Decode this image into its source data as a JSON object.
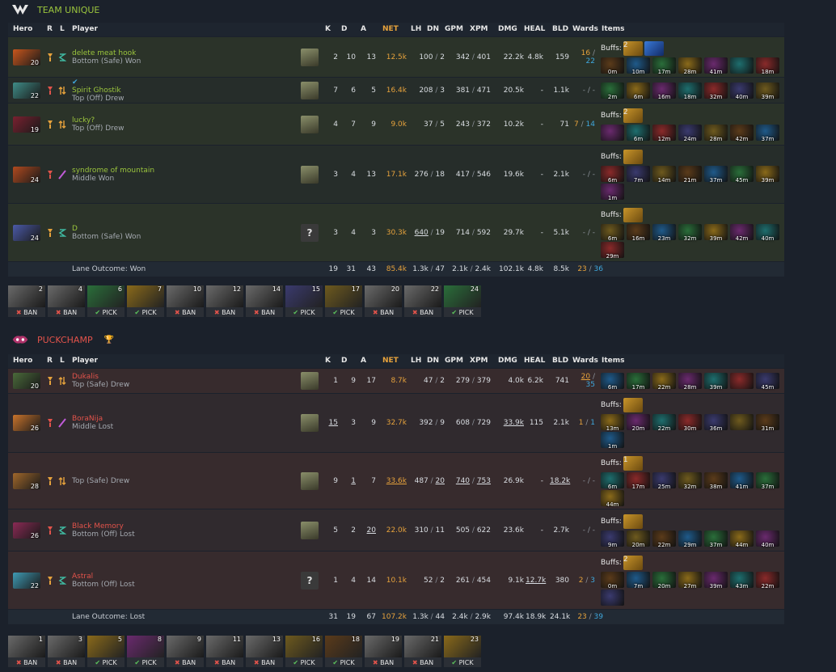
{
  "headers": {
    "hero": "Hero",
    "r": "R",
    "l": "L",
    "player": "Player",
    "k": "K",
    "d": "D",
    "a": "A",
    "net": "NET",
    "lh": "LH",
    "dn": "DN",
    "gpm": "GPM",
    "xpm": "XPM",
    "dmg": "DMG",
    "heal": "HEAL",
    "bld": "BLD",
    "wards": "Wards",
    "items": "Items"
  },
  "buffs_label": "Buffs:",
  "teams": [
    {
      "name": "TEAM UNIQUE",
      "lane_outcome": "Lane Outcome: Won",
      "totals": {
        "k": "19",
        "d": "31",
        "a": "43",
        "net": "85.4k",
        "lh": "1.3k",
        "dn": "47",
        "gpm": "2.1k",
        "xpm": "2.4k",
        "dmg": "102.1k",
        "heal": "4.8k",
        "bld": "8.5k",
        "wo": "23",
        "ws": "36"
      },
      "players": [
        {
          "name": "delete meat hook",
          "lane": "Bottom (Safe) Won",
          "level": "20",
          "k": "2",
          "d": "10",
          "a": "13",
          "net": "12.5k",
          "lh": "100",
          "dn": "2",
          "gpm": "342",
          "xpm": "401",
          "dmg": "22.2k",
          "heal": "4.8k",
          "bld": "159",
          "wo": "16",
          "ws": "22",
          "buffs": [
            "2",
            ""
          ],
          "items": [
            "0m",
            "10m",
            "17m",
            "28m",
            "41m",
            "",
            "18m"
          ],
          "avatar": "",
          "hero_color": "#c8561d"
        },
        {
          "name": "Spirit Ghostik",
          "lane": "Top (Off) Drew",
          "level": "22",
          "k": "7",
          "d": "6",
          "a": "5",
          "net": "16.4k",
          "lh": "208",
          "dn": "3",
          "gpm": "381",
          "xpm": "471",
          "dmg": "20.5k",
          "heal": "-",
          "bld": "1.1k",
          "wo": "-",
          "ws": "-",
          "buffs": [],
          "items": [
            "2m",
            "6m",
            "16m",
            "18m",
            "32m",
            "40m",
            "39m"
          ],
          "avatar": "",
          "hero_color": "#3f8c87"
        },
        {
          "name": "lucky?",
          "lane": "Top (Off) Drew",
          "level": "19",
          "k": "4",
          "d": "7",
          "a": "9",
          "net": "9.0k",
          "lh": "37",
          "dn": "5",
          "gpm": "243",
          "xpm": "372",
          "dmg": "10.2k",
          "heal": "-",
          "bld": "71",
          "wo": "7",
          "ws": "14",
          "buffs": [
            "2"
          ],
          "items": [
            "",
            "6m",
            "12m",
            "24m",
            "28m",
            "42m",
            "37m"
          ],
          "avatar": "",
          "hero_color": "#7a2130"
        },
        {
          "name": "syndrome of mountain",
          "lane": "Middle Won",
          "level": "24",
          "k": "3",
          "d": "4",
          "a": "13",
          "net": "17.1k",
          "lh": "276",
          "dn": "18",
          "gpm": "417",
          "xpm": "546",
          "dmg": "19.6k",
          "heal": "-",
          "bld": "2.1k",
          "wo": "-",
          "ws": "-",
          "buffs": [
            ""
          ],
          "items": [
            "6m",
            "7m",
            "14m",
            "21m",
            "37m",
            "45m",
            "39m",
            "1m"
          ],
          "avatar": "",
          "hero_color": "#b14a1f"
        },
        {
          "name": "D",
          "lane": "Bottom (Safe) Won",
          "level": "24",
          "k": "3",
          "d": "4",
          "a": "3",
          "net": "30.3k",
          "lh": "640",
          "dn": "19",
          "gpm": "714",
          "xpm": "592",
          "dmg": "29.7k",
          "heal": "-",
          "bld": "5.1k",
          "wo": "-",
          "ws": "-",
          "buffs": [
            ""
          ],
          "items": [
            "6m",
            "16m",
            "23m",
            "32m",
            "39m",
            "42m",
            "40m",
            "29m"
          ],
          "avatar": "?",
          "hero_color": "#4b5aa8"
        }
      ],
      "draft": [
        {
          "n": "2",
          "t": "BAN"
        },
        {
          "n": "4",
          "t": "BAN"
        },
        {
          "n": "6",
          "t": "PICK"
        },
        {
          "n": "7",
          "t": "PICK"
        },
        {
          "n": "10",
          "t": "BAN"
        },
        {
          "n": "12",
          "t": "BAN"
        },
        {
          "n": "14",
          "t": "BAN"
        },
        {
          "n": "15",
          "t": "PICK"
        },
        {
          "n": "17",
          "t": "PICK"
        },
        {
          "n": "20",
          "t": "BAN"
        },
        {
          "n": "22",
          "t": "BAN"
        },
        {
          "n": "24",
          "t": "PICK"
        }
      ]
    },
    {
      "name": "PUCKCHAMP",
      "lane_outcome": "Lane Outcome: Lost",
      "totals": {
        "k": "31",
        "d": "19",
        "a": "67",
        "net": "107.2k",
        "lh": "1.3k",
        "dn": "44",
        "gpm": "2.4k",
        "xpm": "2.9k",
        "dmg": "97.4k",
        "heal": "18.9k",
        "bld": "24.1k",
        "wo": "23",
        "ws": "39"
      },
      "players": [
        {
          "name": "Dukalis",
          "lane": "Top (Safe) Drew",
          "level": "20",
          "k": "1",
          "d": "9",
          "a": "17",
          "net": "8.7k",
          "lh": "47",
          "dn": "2",
          "gpm": "279",
          "xpm": "379",
          "dmg": "4.0k",
          "heal": "6.2k",
          "bld": "741",
          "wo": "20",
          "ws": "35",
          "buffs": [],
          "items": [
            "6m",
            "17m",
            "22m",
            "28m",
            "39m",
            "",
            "45m"
          ],
          "avatar": "",
          "hero_color": "#4a6a3a"
        },
        {
          "name": "BoraNija",
          "lane": "Middle Lost",
          "level": "26",
          "k": "15",
          "d": "3",
          "a": "9",
          "net": "32.7k",
          "lh": "392",
          "dn": "9",
          "gpm": "608",
          "xpm": "729",
          "dmg": "33.9k",
          "heal": "115",
          "bld": "2.1k",
          "wo": "1",
          "ws": "1",
          "buffs": [
            ""
          ],
          "items": [
            "13m",
            "20m",
            "22m",
            "30m",
            "36m",
            "",
            "31m",
            "1m"
          ],
          "avatar": "",
          "hero_color": "#c9742c"
        },
        {
          "name": "",
          "lane": "Top (Safe) Drew",
          "level": "28",
          "k": "9",
          "d": "1",
          "a": "7",
          "net": "33.6k",
          "lh": "487",
          "dn": "20",
          "gpm": "740",
          "xpm": "753",
          "dmg": "26.9k",
          "heal": "-",
          "bld": "18.2k",
          "wo": "-",
          "ws": "-",
          "buffs": [
            "1"
          ],
          "items": [
            "6m",
            "17m",
            "25m",
            "32m",
            "38m",
            "41m",
            "37m",
            "44m"
          ],
          "avatar": "",
          "hero_color": "#a0672b"
        },
        {
          "name": "Black Memory",
          "lane": "Bottom (Off) Lost",
          "level": "26",
          "k": "5",
          "d": "2",
          "a": "20",
          "net": "22.0k",
          "lh": "310",
          "dn": "11",
          "gpm": "505",
          "xpm": "622",
          "dmg": "23.6k",
          "heal": "-",
          "bld": "2.7k",
          "wo": "-",
          "ws": "-",
          "buffs": [
            ""
          ],
          "items": [
            "9m",
            "20m",
            "22m",
            "29m",
            "37m",
            "44m",
            "40m"
          ],
          "avatar": "",
          "hero_color": "#8b2a55"
        },
        {
          "name": "Astral",
          "lane": "Bottom (Off) Lost",
          "level": "22",
          "k": "1",
          "d": "4",
          "a": "14",
          "net": "10.1k",
          "lh": "52",
          "dn": "2",
          "gpm": "261",
          "xpm": "454",
          "dmg": "9.1k",
          "heal": "12.7k",
          "bld": "380",
          "wo": "2",
          "ws": "3",
          "buffs": [
            "2"
          ],
          "items": [
            "0m",
            "7m",
            "20m",
            "27m",
            "39m",
            "43m",
            "22m",
            ""
          ],
          "avatar": "?",
          "hero_color": "#3f9bb4"
        }
      ],
      "draft": [
        {
          "n": "1",
          "t": "BAN"
        },
        {
          "n": "3",
          "t": "BAN"
        },
        {
          "n": "5",
          "t": "PICK"
        },
        {
          "n": "8",
          "t": "PICK"
        },
        {
          "n": "9",
          "t": "BAN"
        },
        {
          "n": "11",
          "t": "BAN"
        },
        {
          "n": "13",
          "t": "BAN"
        },
        {
          "n": "16",
          "t": "PICK"
        },
        {
          "n": "18",
          "t": "PICK"
        },
        {
          "n": "19",
          "t": "BAN"
        },
        {
          "n": "21",
          "t": "BAN"
        },
        {
          "n": "23",
          "t": "PICK"
        }
      ]
    }
  ],
  "colors": {
    "radiant": "#9bc53d",
    "dire": "#e2534b",
    "net": "#e6a23c",
    "sentry": "#3fa7dc"
  }
}
